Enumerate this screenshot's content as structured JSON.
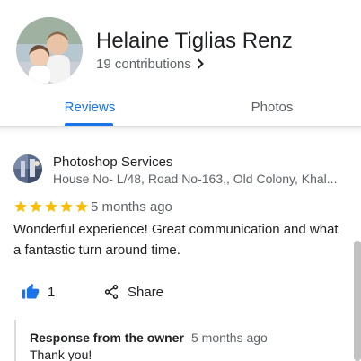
{
  "profile": {
    "name": "Helaine Tiglias Renz",
    "contributions": "19 contributions"
  },
  "tabs": [
    {
      "label": "Reviews",
      "selected": true
    },
    {
      "label": "Photos",
      "selected": false
    }
  ],
  "review": {
    "place_name": "Photoshop Services",
    "place_address": "House No- L/48, Road No-163,, Old Colony, Khal...",
    "rating": 5,
    "max_rating": 5,
    "time": "5 months ago",
    "text": "Wonderful experience! Great communication and what a fantastic turn around time.",
    "like_count": "1",
    "share_label": "Share",
    "owner_response": {
      "label": "Response from the owner",
      "time": "5 months ago",
      "text": "Thank you!"
    }
  },
  "colors": {
    "accent": "#1a73e8",
    "star": "#fbbc04",
    "secondary_text": "#5f6368",
    "divider": "#dadce0"
  }
}
